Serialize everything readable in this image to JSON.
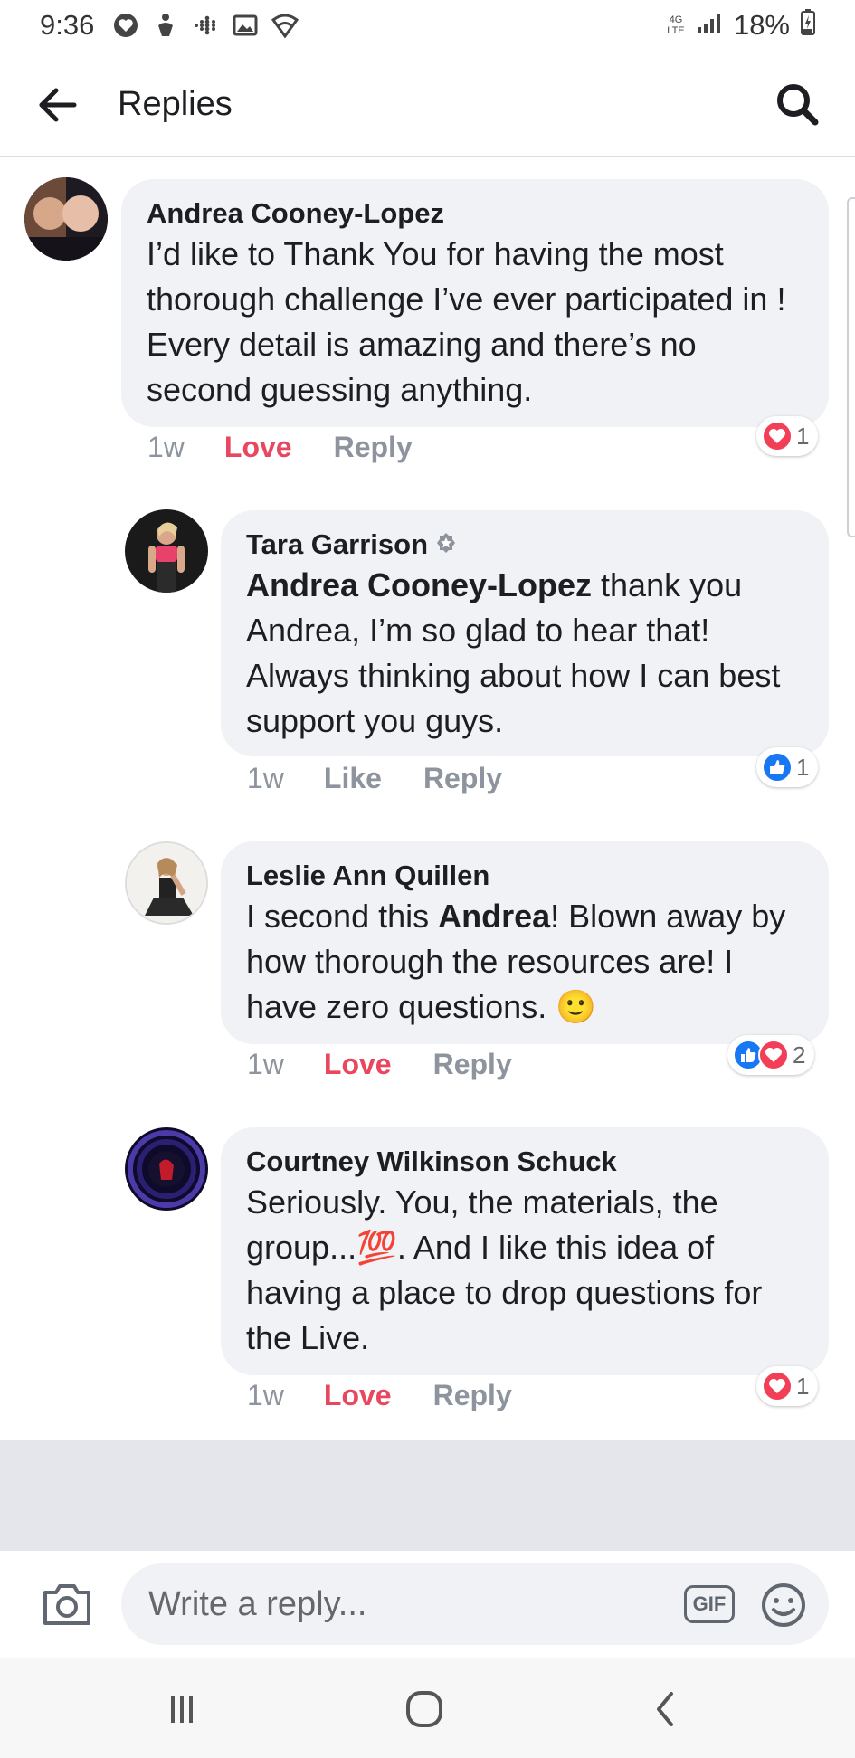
{
  "status_bar": {
    "time": "9:36",
    "network": "4G LTE",
    "battery": "18%",
    "icons": [
      "heart-icon",
      "fitness-icon",
      "fitbit-icon",
      "gallery-icon",
      "wifi-icon"
    ]
  },
  "header": {
    "title": "Replies",
    "back_icon": "back-arrow-icon",
    "search_icon": "search-icon"
  },
  "comments": [
    {
      "author": "Andrea Cooney-Lopez",
      "text_parts": [
        "I’d like to Thank You for having the most thorough challenge I’ve ever participated in ! Every detail is amazing and there’s no second guessing anything."
      ],
      "time": "1w",
      "reaction_label": "Love",
      "reply_label": "Reply",
      "reactions": [
        "heart"
      ],
      "reaction_count": "1"
    },
    {
      "author": "Tara Garrison",
      "verified": true,
      "mention": "Andrea Cooney-Lopez",
      "text": " thank you Andrea, I’m so glad to hear that! Always thinking about how I can best support you guys.",
      "time": "1w",
      "reaction_label": "Like",
      "reply_label": "Reply",
      "reactions": [
        "like"
      ],
      "reaction_count": "1"
    },
    {
      "author": "Leslie Ann Quillen",
      "text_before": "I second this ",
      "mention": "Andrea",
      "text_after": "! Blown away by how thorough the resources are! I have zero questions. 🙂",
      "time": "1w",
      "reaction_label": "Love",
      "reply_label": "Reply",
      "reactions": [
        "like",
        "heart"
      ],
      "reaction_count": "2"
    },
    {
      "author": "Courtney Wilkinson Schuck",
      "text": "Seriously.  You, the materials, the group...💯.  And I like this idea of having a place to drop questions for the Live.",
      "time": "1w",
      "reaction_label": "Love",
      "reply_label": "Reply",
      "reactions": [
        "heart"
      ],
      "reaction_count": "1"
    }
  ],
  "composer": {
    "placeholder": "Write a reply...",
    "gif_label": "GIF"
  },
  "colors": {
    "love": "#e8475f",
    "like": "#1877f2",
    "bubble": "#f0f2f5",
    "muted": "#8d949e"
  }
}
